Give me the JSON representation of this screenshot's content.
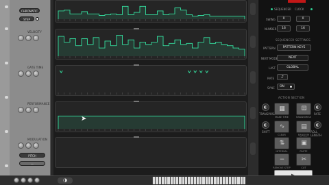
{
  "left": {
    "chromatic_label": "CHROMATIC",
    "step_label": "STEP",
    "lanes": [
      {
        "label": "VELOCITY"
      },
      {
        "label": "GATE TIME"
      },
      {
        "label": "PERFORMANCE"
      },
      {
        "label": "MODULATION"
      }
    ],
    "pitch_label": "PITCH",
    "lane_select": "—"
  },
  "right": {
    "header_left": "SEQUENCER",
    "header_right": "CLOCK",
    "swing_label": "SWING",
    "swing_a": "0",
    "swing_b": "0",
    "grid_label": "NUMBER",
    "grid_a": "16",
    "grid_b": "16",
    "settings_title": "SEQUENCER SETTINGS",
    "pattern_label": "PATTERN",
    "pattern_value": "PATTERN KEYS",
    "mode_label": "NEXT MODE",
    "mode_value": "NEXT",
    "length_label": "LAST",
    "length_value": "GLOBAL",
    "note_label": "RATE",
    "note_value": "♪",
    "sync_label": "SYNC",
    "sync_value": "ON",
    "action_title": "ACTION SECTION",
    "actions": [
      {
        "label": "MAKE TIME",
        "icon": "grid-icon",
        "glyph": "▦"
      },
      {
        "label": "RANDOMISE",
        "icon": "dice-icon",
        "glyph": "⚄"
      },
      {
        "label": "CLEAR",
        "icon": "wave-icon",
        "glyph": "∿"
      },
      {
        "label": "RANDOM LENGTH",
        "icon": "steps-icon",
        "glyph": "▤"
      },
      {
        "label": "INTERVAL",
        "icon": "arrows-icon",
        "glyph": "⇅"
      },
      {
        "label": "PASTE",
        "icon": "copy-icon",
        "glyph": "▣"
      },
      {
        "label": "REMOVE STEP",
        "icon": "minus-icon",
        "glyph": "−"
      },
      {
        "label": "CUT",
        "icon": "cut-icon",
        "glyph": "✂"
      }
    ],
    "side_labels": [
      "TRANSPOSE",
      "SHIFT",
      "RATE",
      "ROLL LENGTH"
    ],
    "play_glyph": "▶"
  },
  "bottom": {
    "page_glyph": "◑"
  },
  "colors": {
    "accent_green": "#2fd195",
    "lane_line": "#35e0a0",
    "red": "#c21717"
  },
  "chart_data": {
    "type": "bar",
    "lanes": [
      {
        "name": "VELOCITY",
        "values": [
          0.55,
          0.6,
          0.35,
          0.35,
          0.5,
          0.35,
          0.35,
          0.25,
          0.3,
          0.35,
          0.3,
          0.85,
          0.3,
          0.45,
          0.85,
          0.3,
          0.3,
          0.55,
          0.3,
          0.35,
          0.75,
          0.6,
          0.3,
          0.2,
          0.25,
          0.3,
          0.2,
          0.2,
          0.2,
          0.2,
          0.2,
          0.2
        ]
      },
      {
        "name": "GATE TIME",
        "values": [
          0.85,
          0.6,
          0.75,
          0.45,
          0.75,
          0.5,
          0.8,
          0.35,
          0.65,
          0.45,
          0.9,
          0.5,
          0.7,
          0.35,
          0.6,
          0.5,
          0.6,
          0.85,
          0.45,
          0.55,
          0.7,
          0.5,
          0.55,
          0.35,
          0.6,
          0.8,
          0.55,
          0.6,
          0.5,
          0.45,
          0.35,
          0.3
        ]
      },
      {
        "name": "PERFORMANCE",
        "values": [
          0.9,
          0,
          0,
          0,
          0,
          0,
          0,
          0,
          0,
          0,
          0,
          0,
          0,
          0,
          0,
          0,
          0,
          0,
          0,
          0,
          0,
          0,
          0.9,
          0.9,
          0.9,
          0.9,
          0,
          0,
          0,
          0,
          0,
          0
        ]
      },
      {
        "name": "MODULATION",
        "values": [
          0.55,
          0.55,
          0.55,
          0.55,
          0.55,
          0.55,
          0.55,
          0.55,
          0.55,
          0.55,
          0.55,
          0.55,
          0.55,
          0.55,
          0.55,
          0.55,
          0.55,
          0.55,
          0.55,
          0.55,
          0.55,
          0.55,
          0.55,
          0.55,
          0.55,
          0.55,
          0.55,
          0.55,
          0.55,
          0.55,
          0.55,
          0.55
        ]
      }
    ]
  }
}
